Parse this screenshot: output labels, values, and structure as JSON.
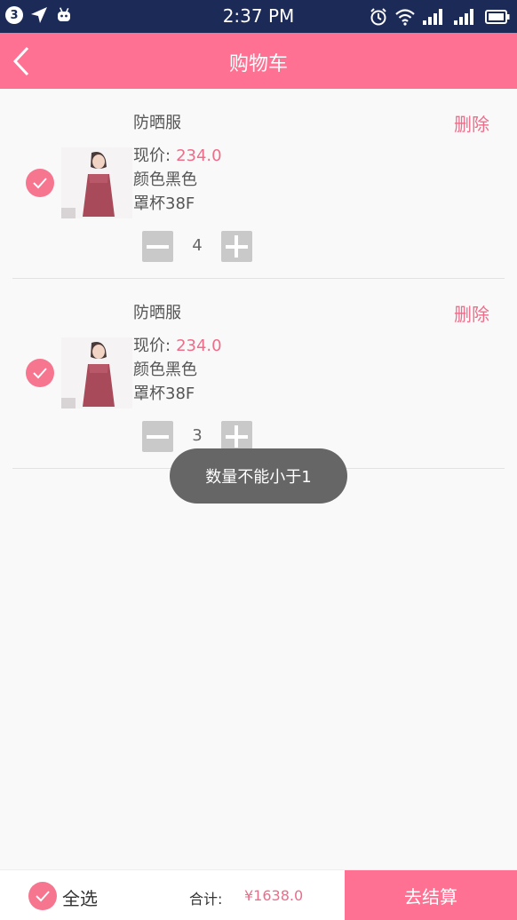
{
  "status_bar": {
    "notification_count": "3",
    "time": "2:37 PM"
  },
  "header": {
    "title": "购物车"
  },
  "items": [
    {
      "name": "防晒服",
      "delete_label": "删除",
      "price_label": "现价:",
      "price": "234.0",
      "color": "颜色黑色",
      "cup": "罩杯38F",
      "quantity": "4"
    },
    {
      "name": "防晒服",
      "delete_label": "删除",
      "price_label": "现价:",
      "price": "234.0",
      "color": "颜色黑色",
      "cup": "罩杯38F",
      "quantity": "3"
    }
  ],
  "toast": "数量不能小于1",
  "bottom_bar": {
    "select_all_label": "全选",
    "total_label": "合计:",
    "total_value": "¥1638.0",
    "checkout_label": "去结算"
  },
  "colors": {
    "accent": "#fe7192",
    "price": "#ec6d8a",
    "status_bar": "#1b2a57"
  }
}
